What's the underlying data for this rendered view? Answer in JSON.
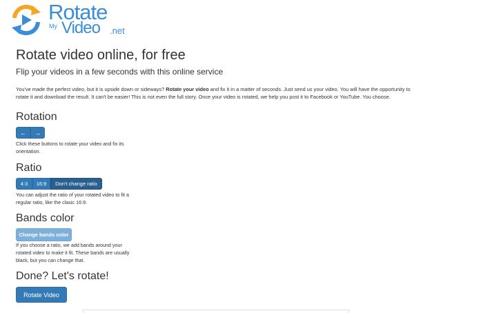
{
  "logo": {
    "rotate": "Rotate",
    "my": "My",
    "video": "Video",
    "net": ".net",
    "icon": "rotate-arrows-play-icon"
  },
  "header": {
    "title": "Rotate video online, for free",
    "subtitle": "Flip your videos in a few seconds with this online service"
  },
  "intro": {
    "part1": "You've made the perfect video, but it is upside down or sideways? ",
    "bold": "Rotate your video",
    "part2": " and fix it in a matter of seconds. Just send us your video. You will have the opportunity to rotate it and download the result. It can't be easier! This is not even the full story. Once your video is rotated, we help you post it to Facebook or YouTube. You choose."
  },
  "rotation": {
    "heading": "Rotation",
    "left_icon": "arrow-left-icon",
    "left_glyph": "←",
    "right_icon": "arrow-right-icon",
    "right_glyph": "→",
    "help": "Click these buttons to rotate your video and fix its orientation."
  },
  "ratio": {
    "heading": "Ratio",
    "options": [
      "4:3",
      "16:9",
      "Don't change ratio"
    ],
    "selected": "Don't change ratio",
    "help": "You can adjust the ratio of your rotated video to fit a regular ratio, like the clasic 16:9."
  },
  "bands": {
    "heading": "Bands color",
    "button": "Change bands color",
    "help": "If you choose a ratio, we add bands around your rotated video to make it fit. These bands are usually black, but you can change that."
  },
  "done": {
    "heading": "Done? Let's rotate!",
    "button": "Rotate Video"
  },
  "colors": {
    "brand_blue": "#3b8ed6",
    "logo_orange": "#f5a623",
    "button_primary": "#337ab7",
    "button_active": "#286090",
    "button_disabled": "#7eb0de"
  }
}
